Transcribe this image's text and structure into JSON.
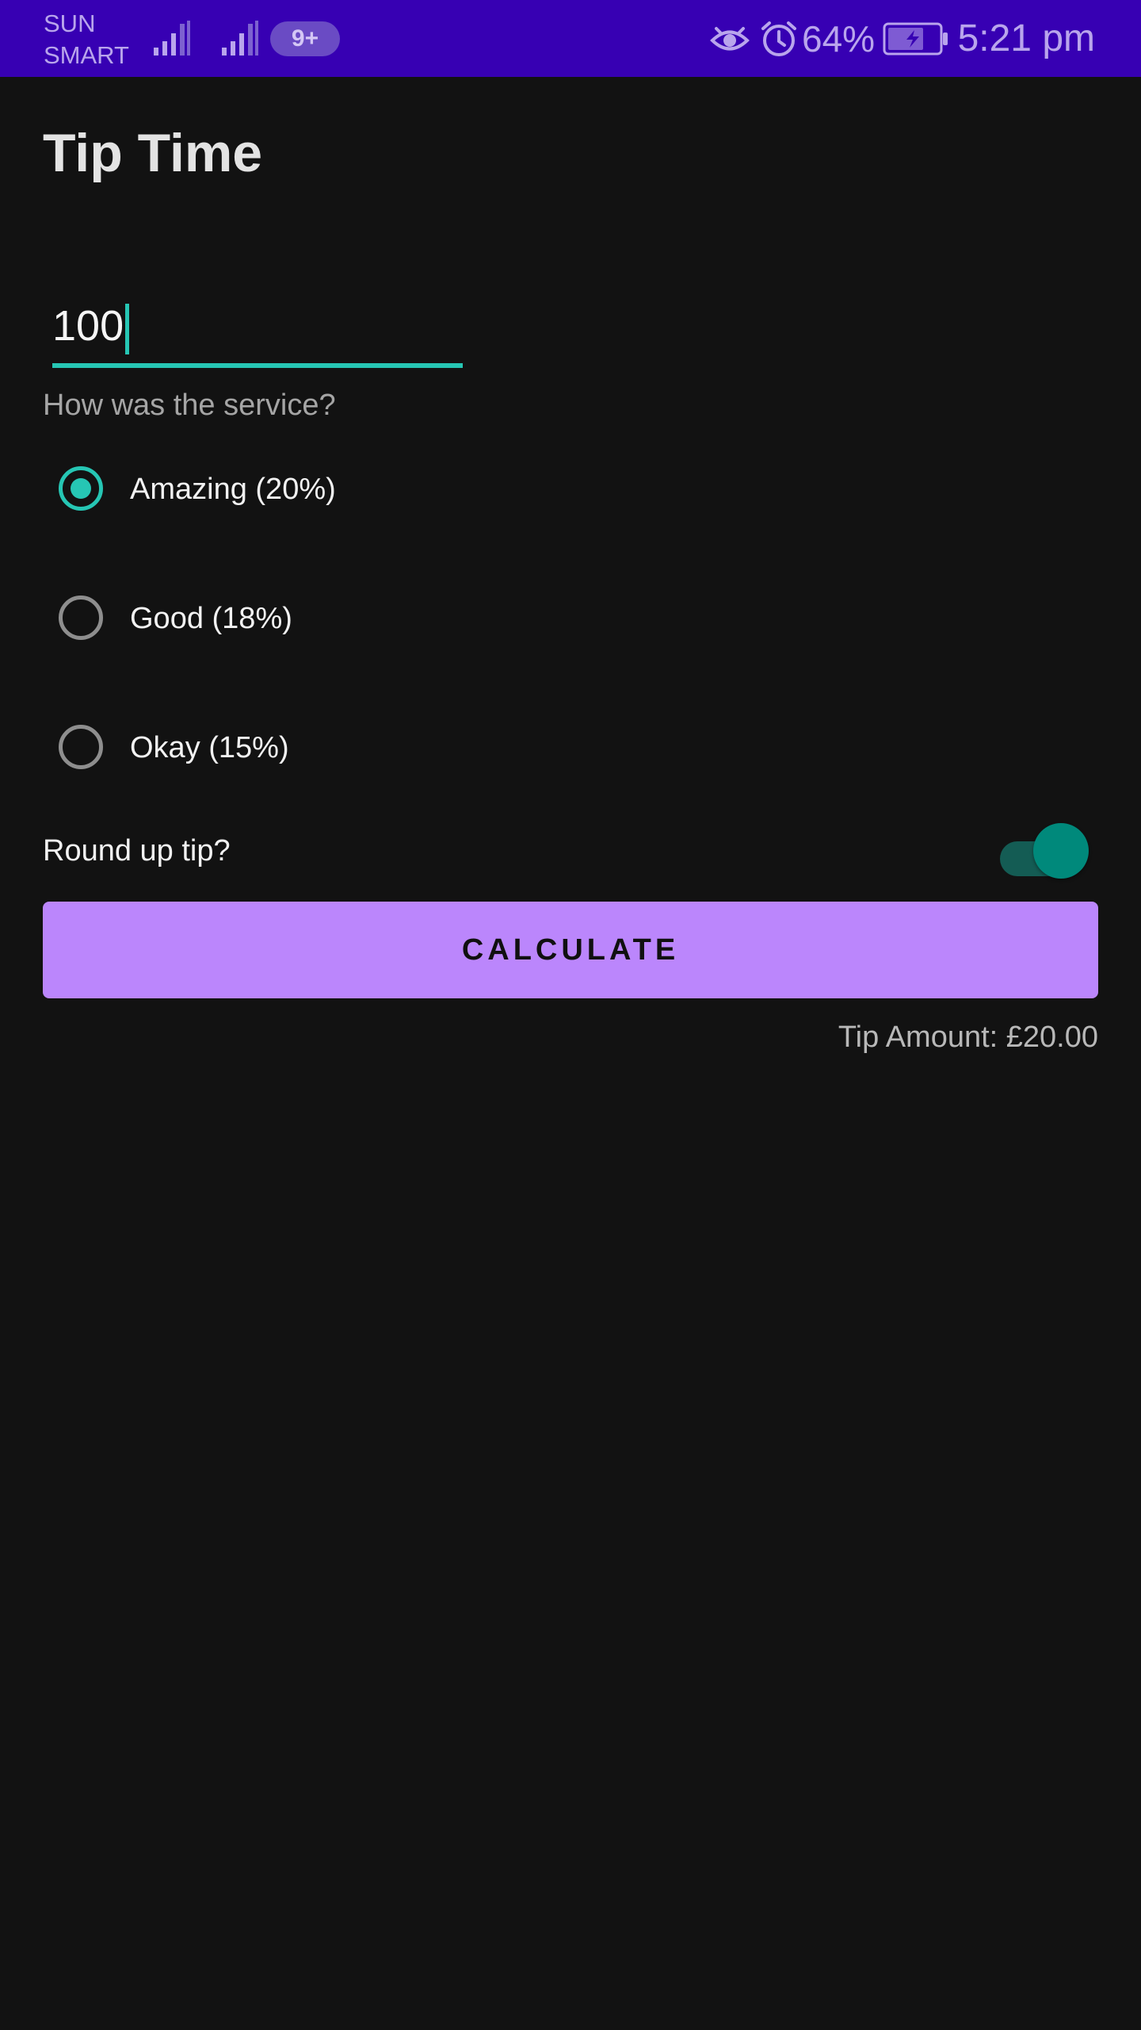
{
  "status_bar": {
    "carrier_line1": "SUN",
    "carrier_line2": "SMART",
    "notification_badge": "9+",
    "battery_percent": "64%",
    "time": "5:21 pm",
    "icons": [
      "signal-icon",
      "signal-icon",
      "eye-icon",
      "alarm-icon",
      "battery-charging-icon"
    ],
    "background_color": "#3700b3"
  },
  "app": {
    "title": "Tip Time",
    "bill_input": {
      "value": "100"
    },
    "service_question": "How was the service?",
    "service_options": [
      {
        "label": "Amazing (20%)",
        "selected": true
      },
      {
        "label": "Good (18%)",
        "selected": false
      },
      {
        "label": "Okay (15%)",
        "selected": false
      }
    ],
    "round_up": {
      "label": "Round up tip?",
      "on": true
    },
    "calculate_button": {
      "label": "CALCULATE"
    },
    "tip_amount": "Tip Amount: £20.00"
  },
  "colors": {
    "background": "#121212",
    "accent": "#26c6b4",
    "primary_button": "#bb86fc",
    "switch_on": "#00897b"
  }
}
